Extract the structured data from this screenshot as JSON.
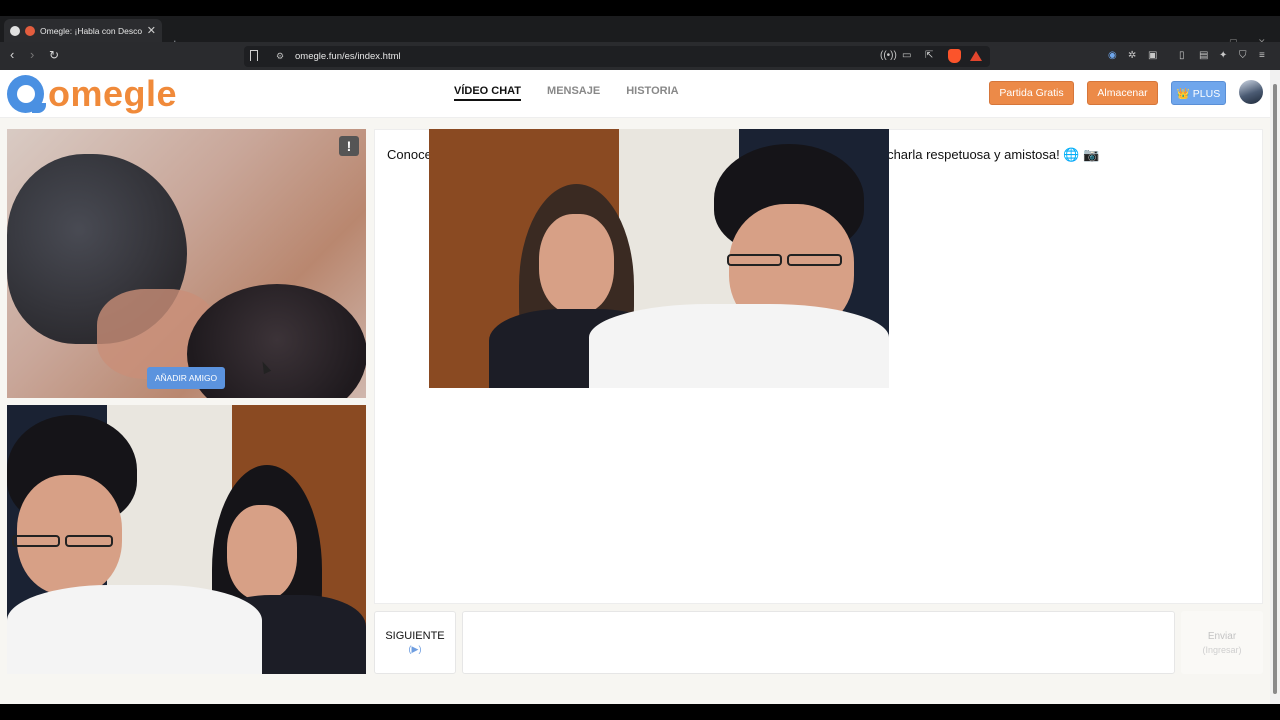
{
  "browser": {
    "tab_title": "Omegle: ¡Habla con Descono",
    "tab_close": "✕",
    "new_tab": "+",
    "url": "omegle.fun/es/index.html",
    "win_min": "—",
    "win_max": "▢",
    "win_close": "✕"
  },
  "header": {
    "logo_text": "omegle",
    "nav": {
      "video_chat": "VÍDEO CHAT",
      "mensaje": "MENSAJE",
      "historia": "HISTORIA"
    },
    "btn_partida": "Partida Gratis",
    "btn_almacenar": "Almacenar",
    "btn_plus": "👑 PLUS"
  },
  "video": {
    "report": "!",
    "add_friend": "AÑADIR AMIGO"
  },
  "chat": {
    "message_start": "Conoce",
    "message_end": "charla respetuosa y amistosa! 🌐 📷"
  },
  "controls": {
    "next_label": "SIGUIENTE",
    "next_sub": "(▶)",
    "send_label": "Enviar",
    "send_sub": "(Ingresar)"
  }
}
